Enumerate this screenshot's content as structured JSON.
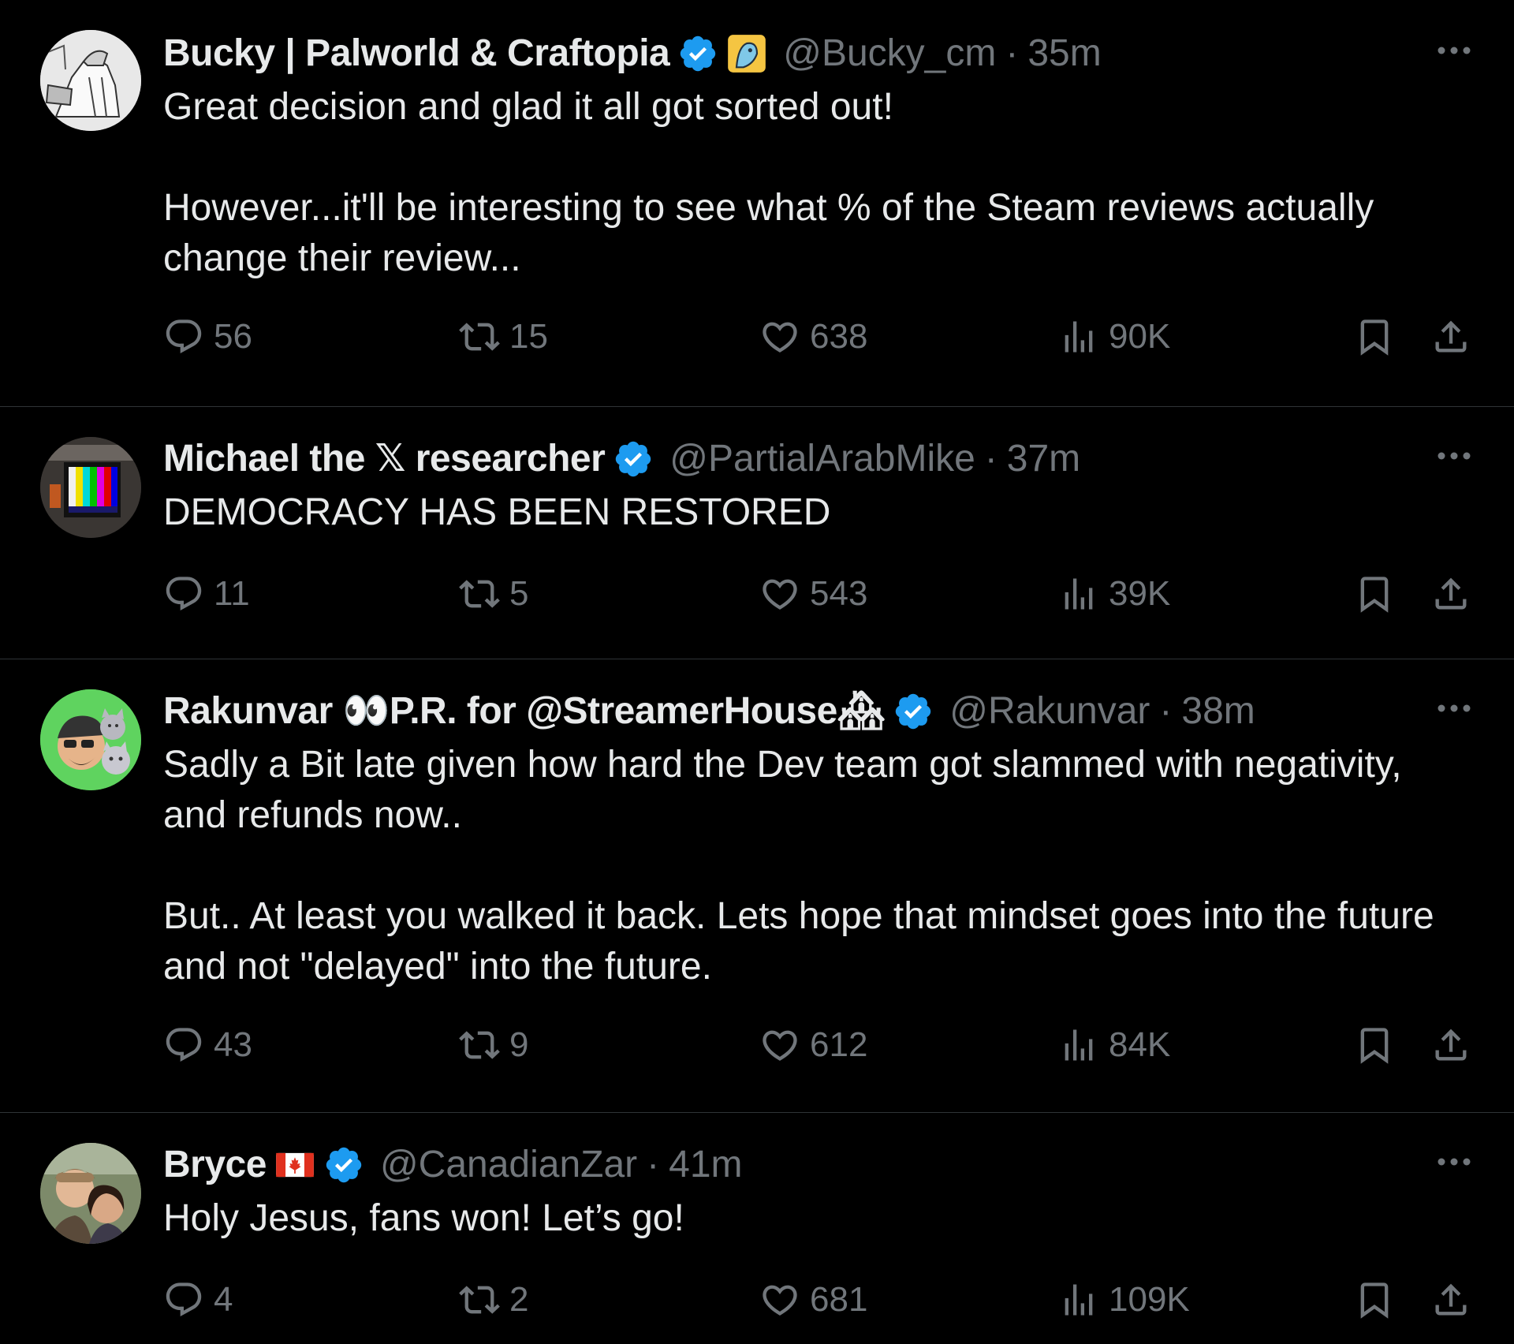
{
  "tweets": [
    {
      "name": "Bucky | Palworld & Craftopia",
      "handle": "@Bucky_cm",
      "separator": "·",
      "time": "35m",
      "text": "Great decision and glad it all got sorted out!\n\nHowever...it'll be interesting to see what % of the Steam reviews actually change their review...",
      "replies": "56",
      "retweets": "15",
      "likes": "638",
      "views": "90K",
      "avatar_icon": "sketch-avatar"
    },
    {
      "name": "Michael the 𝕏 researcher",
      "handle": "@PartialArabMike",
      "separator": "·",
      "time": "37m",
      "text": "DEMOCRACY HAS BEEN RESTORED",
      "replies": "11",
      "retweets": "5",
      "likes": "543",
      "views": "39K",
      "avatar_icon": "color-bars-tv-avatar"
    },
    {
      "name": "Rakunvar 👀P.R. for @StreamerHouse🏘",
      "handle": "@Rakunvar",
      "separator": "·",
      "time": "38m",
      "text": "Sadly a Bit late given how hard the Dev team got slammed with negativity, and refunds now..\n\nBut.. At least you walked it back. Lets hope that mindset goes into the future and not \"delayed\" into the future.",
      "replies": "43",
      "retweets": "9",
      "likes": "612",
      "views": "84K",
      "avatar_icon": "cartoon-cats-avatar"
    },
    {
      "name": "Bryce",
      "handle": "@CanadianZar",
      "separator": "·",
      "time": "41m",
      "text": "Holy Jesus, fans won! Let’s go!",
      "replies": "4",
      "retweets": "2",
      "likes": "681",
      "views": "109K",
      "avatar_icon": "couple-photo-avatar"
    }
  ],
  "colors": {
    "background": "#000000",
    "text": "#e7e9ea",
    "muted": "#71767b",
    "divider": "#2f3336",
    "verified": "#1d9bf0"
  }
}
